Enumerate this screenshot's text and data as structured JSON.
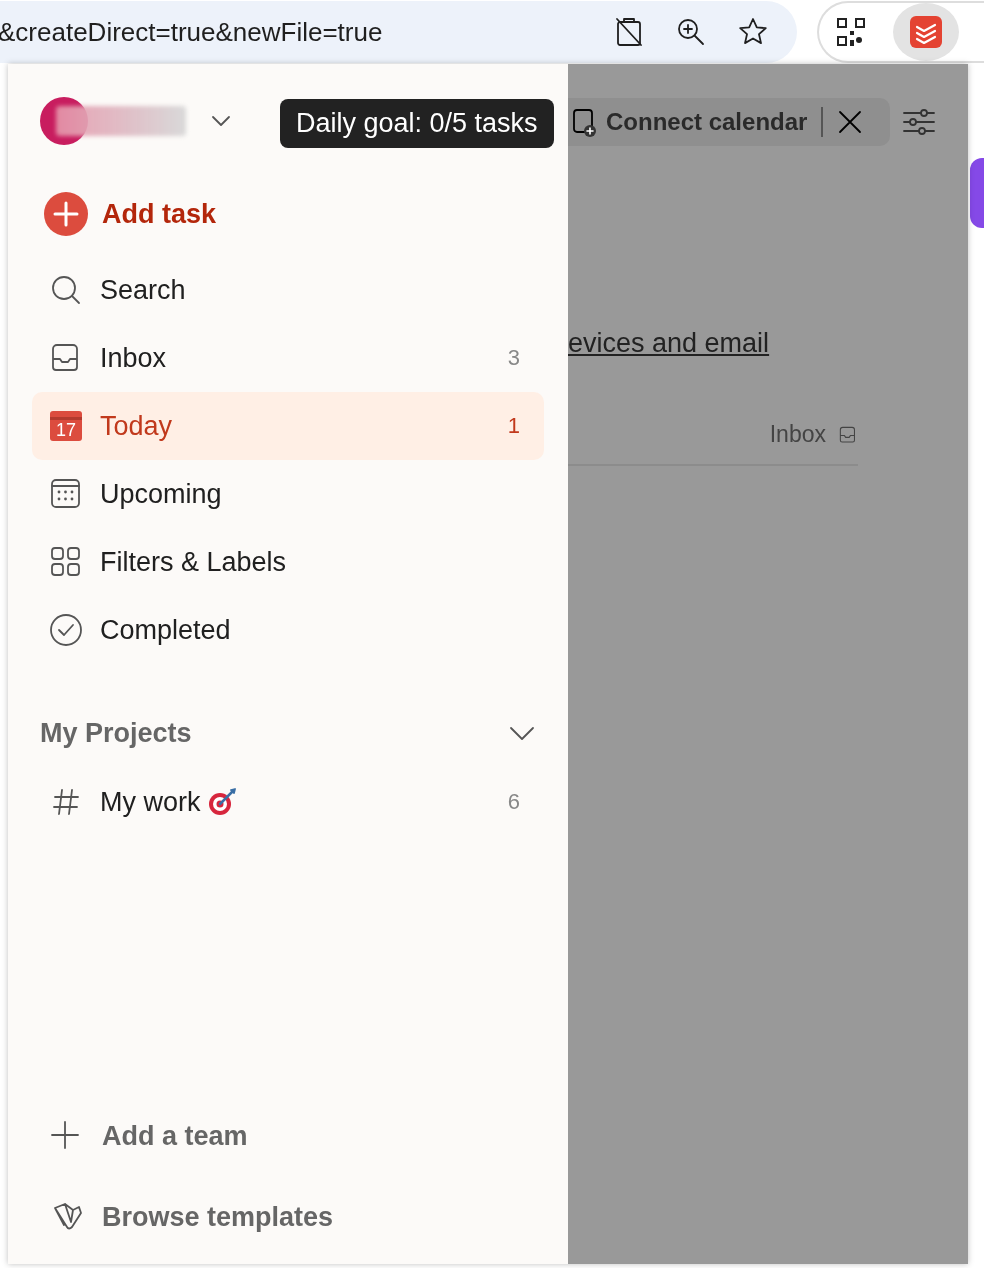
{
  "browser": {
    "address": "&createDirect=true&newFile=true"
  },
  "sidebar": {
    "account": {
      "redacted": true,
      "expanded": false
    },
    "daily_goal_tooltip": "Daily goal: 0/5 tasks",
    "add_task": "Add task",
    "nav": [
      {
        "label": "Search",
        "kind": "search",
        "selected": false
      },
      {
        "label": "Inbox",
        "kind": "inbox",
        "count": "3",
        "selected": false
      },
      {
        "label": "Today",
        "kind": "today",
        "icon_text": "17",
        "count": "1",
        "selected": true
      },
      {
        "label": "Upcoming",
        "kind": "upcoming",
        "selected": false
      },
      {
        "label": "Filters & Labels",
        "kind": "filters",
        "selected": false
      },
      {
        "label": "Completed",
        "kind": "completed",
        "selected": false
      }
    ],
    "projects": {
      "title": "My Projects",
      "expanded": true,
      "items": [
        {
          "label": "My work",
          "count": "6"
        }
      ]
    },
    "footer": [
      {
        "label": "Add a team",
        "kind": "plus"
      },
      {
        "label": "Browse templates",
        "kind": "templates"
      }
    ]
  },
  "background": {
    "connect_calendar": "Connect calendar",
    "link": "evices and email",
    "task_project": "Inbox"
  }
}
